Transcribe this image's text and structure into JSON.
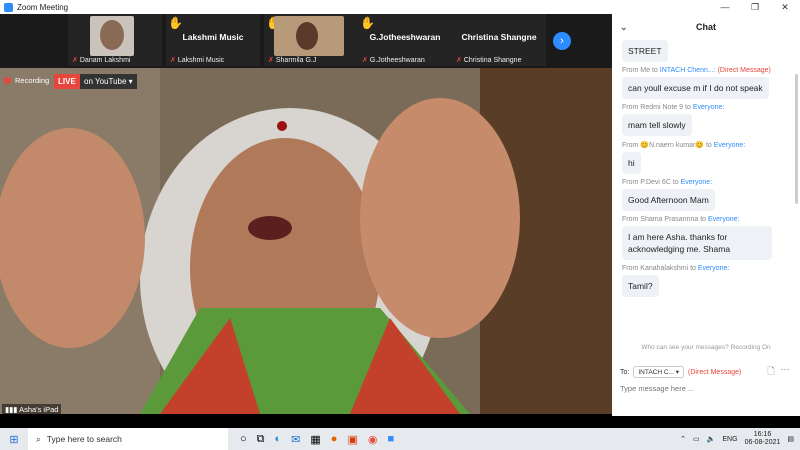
{
  "window": {
    "title": "Zoom Meeting"
  },
  "participants": [
    {
      "label": "Danam Lakshmi",
      "has_video": true,
      "hand_raised": false
    },
    {
      "label": "Lakshmi Music",
      "name": "Lakshmi Music",
      "has_video": false,
      "hand_raised": true
    },
    {
      "label": "Sharmila G.J",
      "has_video": true,
      "hand_raised": true
    },
    {
      "label": "G.Jotheeshwaran",
      "name": "G.Jotheeshwaran",
      "has_video": false,
      "hand_raised": true
    },
    {
      "label": "Christina Shangne",
      "name": "Christina Shangne",
      "has_video": false,
      "hand_raised": false
    }
  ],
  "recording": {
    "label": "Recording",
    "live": "LIVE",
    "platform": "on YouTube ▾"
  },
  "speaker": {
    "name": "Asha's iPad"
  },
  "chat": {
    "title": "Chat",
    "messages": [
      {
        "text": "STREET"
      },
      {
        "from": "From Me to",
        "to": "INTACH Chenn...:",
        "dm": "(Direct Message)",
        "text": "can youll excuse m if I do not speak"
      },
      {
        "from": "From Redmi Note 9 to",
        "to": "Everyone:",
        "text": "mam tell slowly"
      },
      {
        "from": "From 😊N.naern kumar😊 to",
        "to": "Everyone:",
        "text": "hi"
      },
      {
        "from": "From P.Devi 6C to",
        "to": "Everyone:",
        "text": "Good Afternoon Mam"
      },
      {
        "from": "From Shama Prasannna to",
        "to": "Everyone:",
        "text": "I am here Asha. thanks for acknowledging me. Shama"
      },
      {
        "from": "From Kanahalakshmi to",
        "to": "Everyone:",
        "text": "Tamil?"
      }
    ],
    "privacy": "Who can see your messages? Recording On",
    "to_label": "To:",
    "recipient": "INTACH C... ▾",
    "recipient_dm": "(Direct Message)",
    "placeholder": "Type message here ..."
  },
  "taskbar": {
    "search": "Type here to search",
    "lang": "ENG",
    "time": "16:16",
    "date": "06-08-2021"
  }
}
